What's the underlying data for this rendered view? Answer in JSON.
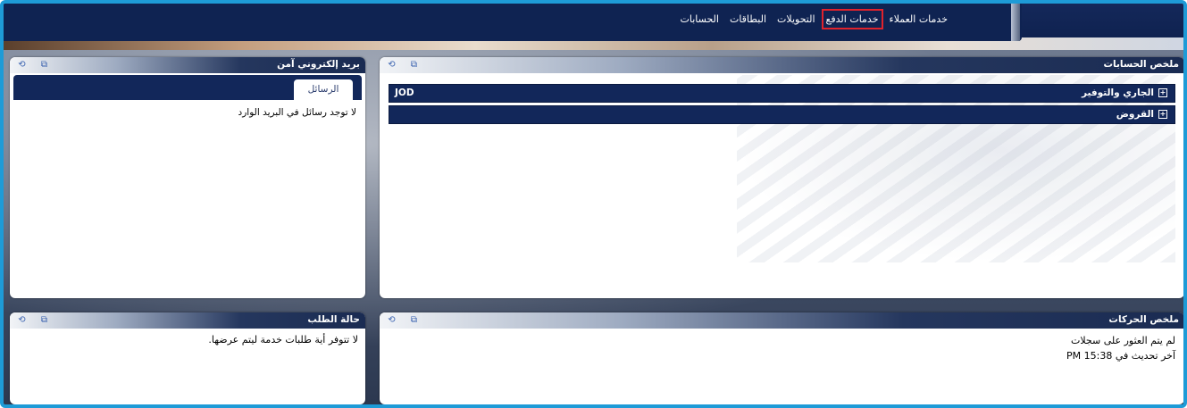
{
  "nav": {
    "items": [
      {
        "label": "الحسابات",
        "active": false
      },
      {
        "label": "البطاقات",
        "active": false
      },
      {
        "label": "التحويلات",
        "active": false
      },
      {
        "label": "خدمات الدفع",
        "active": true
      },
      {
        "label": "خدمات العملاء",
        "active": false
      }
    ]
  },
  "mail_panel": {
    "title": "بريد إلكتروني آمن",
    "tab_label": "الرسائل",
    "empty_message": "لا توجد رسائل في البريد الوارد"
  },
  "accounts_panel": {
    "title": "ملخص الحسابات",
    "rows": [
      {
        "label": "الجاري والتوفير",
        "currency": "JOD"
      },
      {
        "label": "القروض",
        "currency": ""
      }
    ]
  },
  "request_panel": {
    "title": "حالة الطلب",
    "message": "لا تتوفر أية طلبات خدمة ليتم عرضها."
  },
  "transactions_panel": {
    "title": "ملخص الحركات",
    "no_records": "لم يتم العثور على سجلات",
    "last_update": "آخر تحديث في 15:38 PM"
  },
  "colors": {
    "border": "#1e9bd7",
    "nav_bg": "#0f2352",
    "highlight": "#e0232c"
  },
  "icons": [
    "refresh-icon",
    "popout-icon",
    "expand-icon"
  ]
}
